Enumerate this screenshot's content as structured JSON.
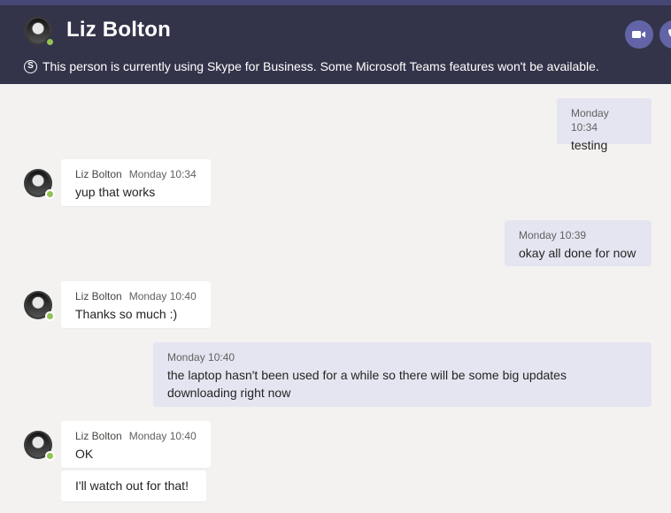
{
  "header": {
    "name": "Liz Bolton",
    "notice": "This person is currently using Skype for Business. Some Microsoft Teams features won't be available.",
    "skype_glyph": "S"
  },
  "colors": {
    "header_bg": "#33344a",
    "accent": "#6264a7",
    "my_bubble": "#e5e5f1",
    "presence_available": "#92c353"
  },
  "messages": [
    {
      "side": "mine",
      "time": "Monday 10:34",
      "lines": [
        "testing"
      ]
    },
    {
      "side": "theirs",
      "sender": "Liz Bolton",
      "time": "Monday 10:34",
      "lines": [
        "yup that works"
      ]
    },
    {
      "side": "mine",
      "time": "Monday 10:39",
      "lines": [
        "okay all done for now"
      ]
    },
    {
      "side": "theirs",
      "sender": "Liz Bolton",
      "time": "Monday 10:40",
      "lines": [
        "Thanks so much :)"
      ]
    },
    {
      "side": "mine",
      "time": "Monday 10:40",
      "lines": [
        "the laptop hasn't been used for a while so there will be some big updates",
        "downloading right now"
      ]
    },
    {
      "side": "theirs",
      "sender": "Liz Bolton",
      "time": "Monday 10:40",
      "lines": [
        "OK"
      ]
    },
    {
      "side": "theirs-continued",
      "lines": [
        "I'll watch out for that!"
      ]
    }
  ]
}
